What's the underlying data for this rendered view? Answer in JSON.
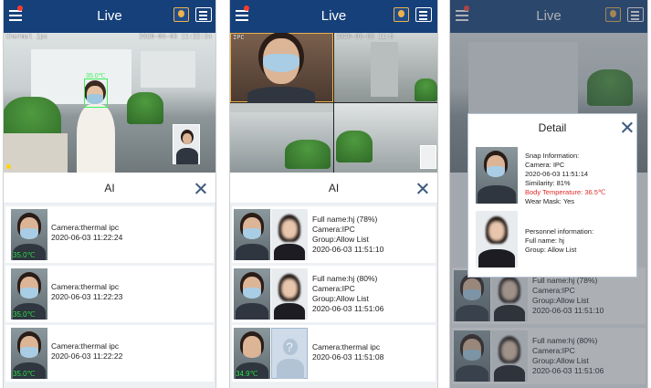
{
  "colors": {
    "topbar": "#16407a",
    "temp_normal": "#3df25a",
    "temp_high": "#ff4a3a",
    "alert_text": "#e02b2b",
    "facebox": "#3df25a"
  },
  "icons": {
    "menu": "menu-icon",
    "face": "face-recognition-icon",
    "grid": "list-view-icon",
    "close": "close-icon",
    "unknown": "unknown-person-icon"
  },
  "screen1": {
    "title": "Live",
    "osd_name": "thermal ipc",
    "osd_time": "2020-06-03 11:22:24",
    "face_temp": "35.0℃",
    "ai_title": "AI",
    "items": [
      {
        "camera": "Camera:thermal ipc",
        "time": "2020-06-03 11:22:24",
        "temp": "35.0℃"
      },
      {
        "camera": "Camera:thermal ipc",
        "time": "2020-06-03 11:22:23",
        "temp": "35.0℃"
      },
      {
        "camera": "Camera:thermal ipc",
        "time": "2020-06-03 11:22:22",
        "temp": "35.0℃"
      }
    ]
  },
  "screen2": {
    "title": "Live",
    "osd_left": "IPC",
    "osd_time": "2020-06-03 11:5",
    "ai_title": "AI",
    "items": [
      {
        "line1": "Full name:hj  (78%)",
        "line2": "Camera:IPC",
        "line3": "Group:Allow List",
        "line4": "2020-06-03 11:51:10",
        "temp": ""
      },
      {
        "line1": "Full name:hj  (80%)",
        "line2": "Camera:IPC",
        "line3": "Group:Allow List",
        "line4": "2020-06-03 11:51:06",
        "temp": ""
      },
      {
        "line1": "Camera:thermal ipc",
        "line2": "2020-06-03 11:51:08",
        "temp": "34.9℃"
      }
    ]
  },
  "screen3": {
    "title": "Live",
    "dialog": {
      "title": "Detail",
      "snap_header": "Snap Information:",
      "camera": "Camera: IPC",
      "time": "2020-06-03 11:51:14",
      "similarity": "Similarity: 81%",
      "body_temp": "Body Temperature: 36.5℃",
      "wear_mask": "Wear Mask: Yes",
      "personnel_header": "Personnel information:",
      "full_name": "Full name: hj",
      "group": "Group: Allow List"
    },
    "items": [
      {
        "line1": "Full name:hj  (78%)",
        "line2": "Camera:IPC",
        "line3": "Group:Allow List",
        "line4": "2020-06-03 11:51:10"
      },
      {
        "line1": "Full name:hj  (80%)",
        "line2": "Camera:IPC",
        "line3": "Group:Allow List",
        "line4": "2020-06-03 11:51:06"
      }
    ]
  }
}
